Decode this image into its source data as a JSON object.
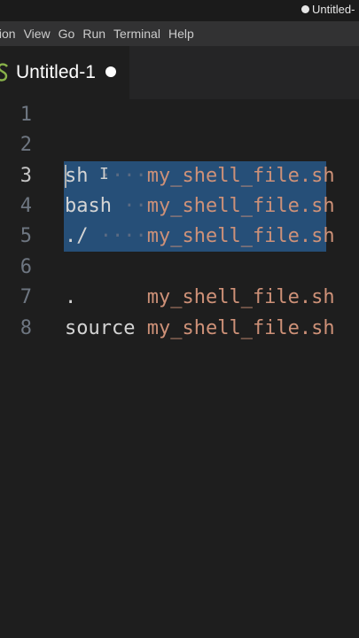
{
  "window": {
    "title": "Untitled-"
  },
  "menu": [
    "tion",
    "View",
    "Go",
    "Run",
    "Terminal",
    "Help"
  ],
  "tab": {
    "label": "Untitled-1",
    "icon": "shell-script-icon",
    "dirty": true
  },
  "lines": [
    {
      "n": "1",
      "cmd": "",
      "file": ""
    },
    {
      "n": "2",
      "cmd": "",
      "file": ""
    },
    {
      "n": "3",
      "cmd": "sh",
      "ws": "····",
      "file": "my_shell_file.sh"
    },
    {
      "n": "4",
      "cmd": "bash",
      "ws": "··",
      "file": "my_shell_file.sh"
    },
    {
      "n": "5",
      "cmd": "./",
      "ws": "····",
      "file": "my_shell_file.sh"
    },
    {
      "n": "6",
      "cmd": "",
      "file": ""
    },
    {
      "n": "7",
      "cmd": ".",
      "ws": "",
      "file": "my_shell_file.sh"
    },
    {
      "n": "8",
      "cmd": "source",
      "ws": "",
      "file": "my_shell_file.sh"
    }
  ],
  "colors": {
    "selection": "#264f78",
    "filename": "#ce9178",
    "background": "#1e1e1e"
  }
}
